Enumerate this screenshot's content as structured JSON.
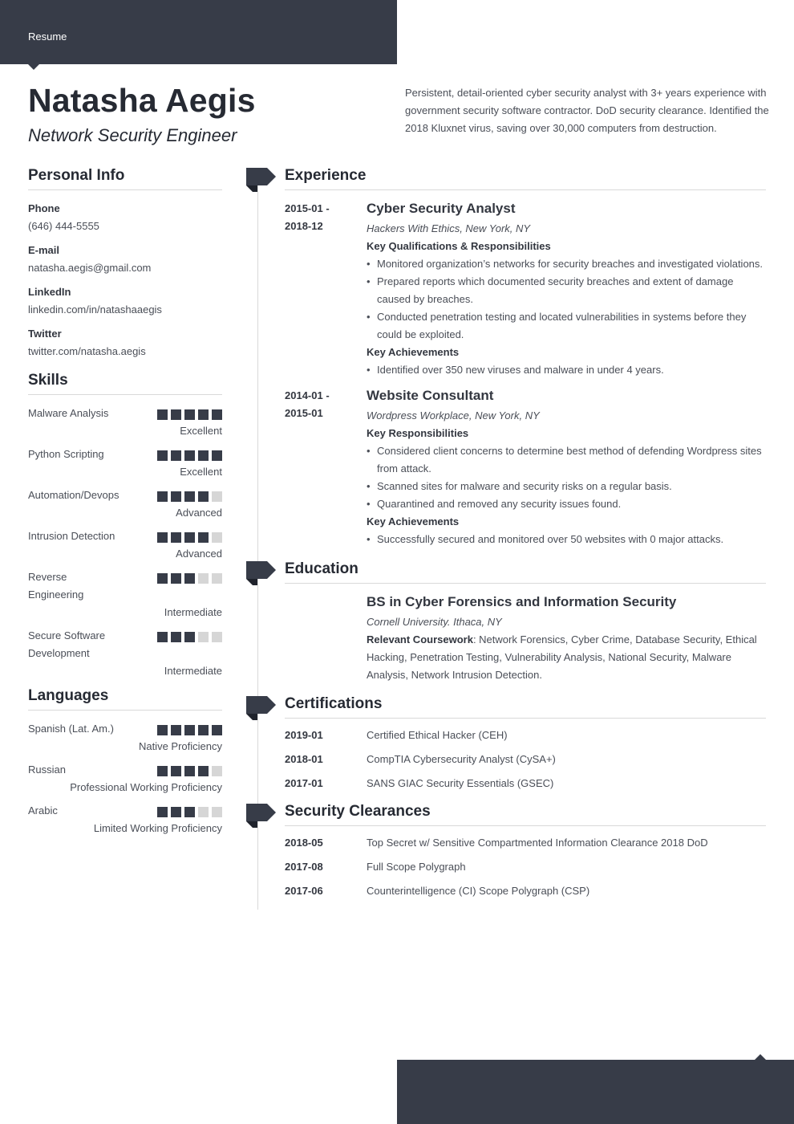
{
  "header": {
    "tab_label": "Resume"
  },
  "profile": {
    "name": "Natasha Aegis",
    "title": "Network Security Engineer",
    "summary": "Persistent, detail-oriented cyber security analyst with 3+ years experience with government security software contractor. DoD security clearance. Identified the 2018 Kluxnet virus, saving over 30,000 computers from destruction."
  },
  "personal_info": {
    "heading": "Personal Info",
    "items": [
      {
        "label": "Phone",
        "value": "(646) 444-5555"
      },
      {
        "label": "E-mail",
        "value": "natasha.aegis@gmail.com"
      },
      {
        "label": "LinkedIn",
        "value": "linkedin.com/in/natashaaegis"
      },
      {
        "label": "Twitter",
        "value": "twitter.com/natasha.aegis"
      }
    ]
  },
  "skills": {
    "heading": "Skills",
    "max_rating": 5,
    "items": [
      {
        "name": "Malware Analysis",
        "rating": 5,
        "level": "Excellent"
      },
      {
        "name": "Python Scripting",
        "rating": 5,
        "level": "Excellent"
      },
      {
        "name": "Automation/Devops",
        "rating": 4,
        "level": "Advanced"
      },
      {
        "name": "Intrusion Detection",
        "rating": 4,
        "level": "Advanced"
      },
      {
        "name": "Reverse Engineering",
        "rating": 3,
        "level": "Intermediate"
      },
      {
        "name": "Secure Software Development",
        "rating": 3,
        "level": "Intermediate"
      }
    ]
  },
  "languages": {
    "heading": "Languages",
    "max_rating": 5,
    "items": [
      {
        "name": "Spanish (Lat. Am.)",
        "rating": 5,
        "level": "Native Proficiency"
      },
      {
        "name": "Russian",
        "rating": 4,
        "level": "Professional Working Proficiency"
      },
      {
        "name": "Arabic",
        "rating": 3,
        "level": "Limited Working Proficiency"
      }
    ]
  },
  "experience": {
    "heading": "Experience",
    "jobs": [
      {
        "date_start": "2015-01 -",
        "date_end": "2018-12",
        "title": "Cyber Security Analyst",
        "company": "Hackers With Ethics, New York, NY",
        "resp_heading": "Key Qualifications & Responsibilities",
        "responsibilities": [
          "Monitored organization’s networks for security breaches and investigated violations.",
          "Prepared reports which documented security breaches and extent of damage caused by breaches.",
          "Conducted penetration testing and located vulnerabilities in systems before they could be exploited."
        ],
        "ach_heading": "Key Achievements",
        "achievements": [
          "Identified over 350 new viruses and malware in under 4 years."
        ]
      },
      {
        "date_start": "2014-01 -",
        "date_end": "2015-01",
        "title": "Website Consultant",
        "company": "Wordpress Workplace, New York, NY",
        "resp_heading": "Key Responsibilities",
        "responsibilities": [
          "Considered client concerns to determine best method of defending Wordpress sites from attack.",
          "Scanned sites for malware and security risks on a regular basis.",
          "Quarantined and removed any security issues found."
        ],
        "ach_heading": "Key Achievements",
        "achievements": [
          "Successfully secured and monitored over 50 websites with 0 major attacks."
        ]
      }
    ]
  },
  "education": {
    "heading": "Education",
    "degree": "BS in Cyber Forensics and Information Security",
    "school": "Cornell University. Ithaca, NY",
    "coursework_label": "Relevant Coursework",
    "coursework": ": Network Forensics, Cyber Crime, Database Security, Ethical Hacking, Penetration Testing, Vulnerability Analysis, National Security, Malware Analysis, Network Intrusion Detection."
  },
  "certifications": {
    "heading": "Certifications",
    "items": [
      {
        "date": "2019-01",
        "name": "Certified Ethical Hacker (CEH)"
      },
      {
        "date": "2018-01",
        "name": "CompTIA Cybersecurity Analyst (CySA+)"
      },
      {
        "date": "2017-01",
        "name": "SANS GIAC Security Essentials (GSEC)"
      }
    ]
  },
  "clearances": {
    "heading": "Security Clearances",
    "items": [
      {
        "date": "2018-05",
        "name": "Top Secret w/ Sensitive Compartmented Information Clearance 2018 DoD"
      },
      {
        "date": "2017-08",
        "name": "Full Scope Polygraph"
      },
      {
        "date": "2017-06",
        "name": "Counterintelligence (CI) Scope Polygraph (CSP)"
      }
    ]
  },
  "colors": {
    "accent_dark": "#373c48",
    "flag_shadow": "#1f232c",
    "rating_off": "#d6d6d6"
  }
}
